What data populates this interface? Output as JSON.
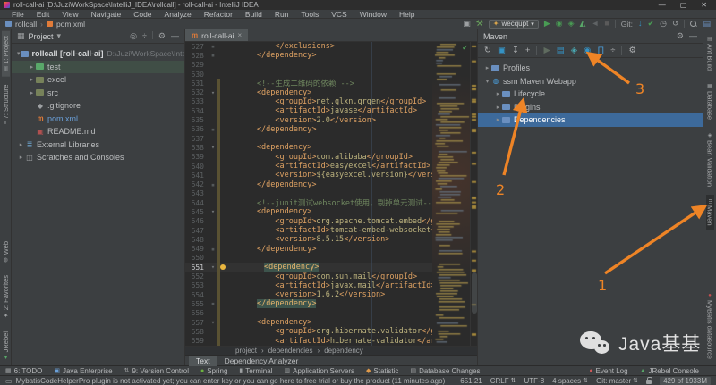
{
  "window": {
    "title": "roll-call-ai [D:\\Juzi\\WorkSpace\\IntelliJ_IDEA\\rollcall] - roll-call-ai - IntelliJ IDEA",
    "minimize": "—",
    "maximize": "▢",
    "close": "✕"
  },
  "menubar": [
    "File",
    "Edit",
    "View",
    "Navigate",
    "Code",
    "Analyze",
    "Refactor",
    "Build",
    "Run",
    "Tools",
    "VCS",
    "Window",
    "Help"
  ],
  "navbar": {
    "crumbs": [
      {
        "label": "rollcall",
        "icon": "module-icon",
        "color": "#6a8fbf"
      },
      {
        "label": "pom.xml",
        "icon": "maven-file-icon",
        "color": "#e07b39"
      }
    ],
    "crumb_sep": "›",
    "left_icons": [
      {
        "name": "tool-layout-icon",
        "g": "▣",
        "c": "#9da0a2"
      },
      {
        "name": "build-hammer-icon",
        "g": "⚒",
        "c": "#6ba65d"
      }
    ],
    "run_config": {
      "icon": "tomcat-icon",
      "label": "wecqupt",
      "arrow": "▾"
    },
    "run_icons": [
      {
        "name": "run-icon",
        "g": "▶",
        "c": "#499c54"
      },
      {
        "name": "debug-icon",
        "g": "◉",
        "c": "#499c54"
      },
      {
        "name": "coverage-icon",
        "g": "◈",
        "c": "#499c54"
      },
      {
        "name": "profiler-icon",
        "g": "◭",
        "c": "#59a869"
      },
      {
        "name": "rerun-icon",
        "g": "◄",
        "c": "#5f6365"
      },
      {
        "name": "stop-icon",
        "g": "■",
        "c": "#5a5a5a"
      }
    ],
    "git_label": "Git:",
    "git_icons": [
      {
        "name": "git-update-icon",
        "g": "↓",
        "c": "#3592c4"
      },
      {
        "name": "git-commit-icon",
        "g": "✔",
        "c": "#499c54"
      },
      {
        "name": "history-icon",
        "g": "◷",
        "c": "#9da0a2"
      },
      {
        "name": "rollback-icon",
        "g": "↺",
        "c": "#9da0a2"
      }
    ],
    "tail_icons": [
      {
        "name": "search-everywhere-icon",
        "g": "MAG",
        "c": "#9da0a2"
      },
      {
        "name": "bookmarks-icon",
        "g": "▤",
        "c": "#6a8fbf"
      }
    ]
  },
  "left_stripe": {
    "top": [
      {
        "label": "1: Project",
        "icon": "▥",
        "active": true
      },
      {
        "label": "7: Structure",
        "icon": "≡",
        "active": false
      }
    ],
    "bottom": [
      {
        "label": "Web",
        "icon": "◍",
        "active": false
      },
      {
        "label": "2: Favorites",
        "icon": "★",
        "active": false
      },
      {
        "label": "JRebel",
        "icon": "▲",
        "active": false,
        "iconColor": "#59a869"
      }
    ]
  },
  "right_stripe": {
    "top": [
      {
        "label": "Ant Build",
        "icon": "▤",
        "active": false
      },
      {
        "label": "Database",
        "icon": "▦",
        "active": false
      },
      {
        "label": "Bean Validation",
        "icon": "◈",
        "active": false
      },
      {
        "label": "Maven",
        "icon": "m",
        "active": true
      }
    ],
    "bottom": [
      {
        "label": "MyBatis datasource",
        "icon": "●",
        "active": false,
        "iconColor": "#c24f4f"
      }
    ]
  },
  "project_panel": {
    "title": "Project",
    "title_arrow": "▾",
    "title_icon": "panel-folder-icon",
    "header_icons": [
      {
        "name": "locate-icon",
        "g": "◎"
      },
      {
        "name": "collapse-all-icon",
        "g": "÷"
      },
      {
        "name": "sep",
        "g": "|"
      },
      {
        "name": "settings-gear-icon",
        "g": "⚙"
      },
      {
        "name": "hide-icon",
        "g": "—"
      }
    ],
    "tree": [
      {
        "label": "rollcall [roll-call-ai]",
        "path": "D:\\Juzi\\WorkSpace\\IntelliJ_IDEA\\rollcall",
        "icon": "module",
        "iconColor": "#6a8fbf",
        "arrow": "▾",
        "indent": 0,
        "bold": true
      },
      {
        "label": "test",
        "icon": "folder",
        "iconColor": "#59a869",
        "arrow": "▸",
        "indent": 1,
        "scope": true
      },
      {
        "label": "excel",
        "icon": "folder",
        "iconColor": "#77825a",
        "arrow": "▸",
        "indent": 1
      },
      {
        "label": "src",
        "icon": "folder",
        "iconColor": "#77825a",
        "arrow": "▸",
        "indent": 1
      },
      {
        "label": ".gitignore",
        "icon": "git-file",
        "glyph": "◆",
        "iconColor": "#9da0a2",
        "indent": 1
      },
      {
        "label": "pom.xml",
        "icon": "maven-file",
        "glyph": "m",
        "iconColor": "#e07b39",
        "indent": 1,
        "labelColor": "#6a9fd8"
      },
      {
        "label": "README.md",
        "icon": "readme-file",
        "glyph": "▣",
        "iconColor": "#b05050",
        "indent": 1
      },
      {
        "label": "External Libraries",
        "icon": "libraries",
        "glyph": "≣",
        "iconColor": "#6897bb",
        "arrow": "▸",
        "indent": 0
      },
      {
        "label": "Scratches and Consoles",
        "icon": "scratches",
        "glyph": "◫",
        "iconColor": "#9da0a2",
        "arrow": "▸",
        "indent": 0
      }
    ]
  },
  "editor": {
    "tab": {
      "icon": "m",
      "label": "roll-call-ai",
      "close": "×"
    },
    "inspection_ok": "✔",
    "breadcrumbs": [
      "project",
      "dependencies",
      "dependency"
    ],
    "crumb_sep": "›",
    "view_tabs": [
      {
        "label": "Text",
        "active": true
      },
      {
        "label": "Dependency Analyzer",
        "active": false
      }
    ],
    "lines": [
      {
        "n": 627,
        "end": true,
        "s": [
          [
            "            </exclusions>",
            "t"
          ]
        ]
      },
      {
        "n": 628,
        "end": true,
        "s": [
          [
            "        </dependency>",
            "t"
          ]
        ]
      },
      {
        "n": 629,
        "s": []
      },
      {
        "n": 630,
        "s": []
      },
      {
        "n": 631,
        "chg": true,
        "s": [
          [
            "        ",
            "w"
          ],
          [
            "<!--生成二维码的依赖 -->",
            "c"
          ]
        ]
      },
      {
        "n": 632,
        "fold": true,
        "chg": true,
        "s": [
          [
            "        <dependency>",
            "t"
          ]
        ]
      },
      {
        "n": 633,
        "chg": true,
        "s": [
          [
            "            <groupId>",
            "t"
          ],
          [
            "net.glxn.qrgen",
            "v"
          ],
          [
            "</groupId>",
            "t"
          ]
        ]
      },
      {
        "n": 634,
        "chg": true,
        "s": [
          [
            "            <artifactId>",
            "t"
          ],
          [
            "javase",
            "v"
          ],
          [
            "</artifactId>",
            "t"
          ]
        ]
      },
      {
        "n": 635,
        "chg": true,
        "s": [
          [
            "            <version>",
            "t"
          ],
          [
            "2.0",
            "v"
          ],
          [
            "</version>",
            "t"
          ]
        ]
      },
      {
        "n": 636,
        "end": true,
        "chg": true,
        "s": [
          [
            "        </dependency>",
            "t"
          ]
        ]
      },
      {
        "n": 637,
        "chg": true,
        "s": []
      },
      {
        "n": 638,
        "fold": true,
        "chg": true,
        "s": [
          [
            "        <dependency>",
            "t"
          ]
        ]
      },
      {
        "n": 639,
        "chg": true,
        "s": [
          [
            "            <groupId>",
            "t"
          ],
          [
            "com.alibaba",
            "v"
          ],
          [
            "</groupId>",
            "t"
          ]
        ]
      },
      {
        "n": 640,
        "chg": true,
        "s": [
          [
            "            <artifactId>",
            "t"
          ],
          [
            "easyexcel",
            "v"
          ],
          [
            "</artifactId>",
            "t"
          ]
        ]
      },
      {
        "n": 641,
        "chg": true,
        "s": [
          [
            "            <version>",
            "t"
          ],
          [
            "${easyexcel.version}",
            "v"
          ],
          [
            "</version>",
            "t"
          ]
        ]
      },
      {
        "n": 642,
        "end": true,
        "chg": true,
        "s": [
          [
            "        </dependency>",
            "t"
          ]
        ]
      },
      {
        "n": 643,
        "chg": true,
        "s": []
      },
      {
        "n": 644,
        "chg": true,
        "s": [
          [
            "        ",
            "w"
          ],
          [
            "<!--junit测试websocket使用，剔掉单元测试-->",
            "c"
          ]
        ]
      },
      {
        "n": 645,
        "fold": true,
        "chg": true,
        "s": [
          [
            "        <dependency>",
            "t"
          ]
        ]
      },
      {
        "n": 646,
        "chg": true,
        "s": [
          [
            "            <groupId>",
            "t"
          ],
          [
            "org.apache.tomcat.embed",
            "v"
          ],
          [
            "</groupId>",
            "t"
          ]
        ]
      },
      {
        "n": 647,
        "chg": true,
        "s": [
          [
            "            <artifactId>",
            "t"
          ],
          [
            "tomcat-embed-websocket",
            "v"
          ],
          [
            "</artifactId>",
            "t"
          ]
        ]
      },
      {
        "n": 648,
        "chg": true,
        "s": [
          [
            "            <version>",
            "t"
          ],
          [
            "8.5.15",
            "v"
          ],
          [
            "</version>",
            "t"
          ]
        ]
      },
      {
        "n": 649,
        "end": true,
        "chg": true,
        "s": [
          [
            "        </dependency>",
            "t"
          ]
        ]
      },
      {
        "n": 650,
        "chg": true,
        "s": []
      },
      {
        "n": 651,
        "fold": true,
        "chg": true,
        "cur": true,
        "bulb": true,
        "s": [
          [
            "        ",
            "w"
          ],
          [
            "<dependency>",
            "th"
          ]
        ]
      },
      {
        "n": 652,
        "chg": true,
        "s": [
          [
            "            <groupId>",
            "t"
          ],
          [
            "com.sun.mail",
            "v"
          ],
          [
            "</groupId>",
            "t"
          ]
        ]
      },
      {
        "n": 653,
        "chg": true,
        "s": [
          [
            "            <artifactId>",
            "t"
          ],
          [
            "javax.mail",
            "v"
          ],
          [
            "</artifactId>",
            "t"
          ]
        ]
      },
      {
        "n": 654,
        "chg": true,
        "s": [
          [
            "            <version>",
            "t"
          ],
          [
            "1.6.2",
            "v"
          ],
          [
            "</version>",
            "t"
          ]
        ]
      },
      {
        "n": 655,
        "end": true,
        "chg": true,
        "s": [
          [
            "        ",
            "w"
          ],
          [
            "</dependency>",
            "th"
          ]
        ]
      },
      {
        "n": 656,
        "chg": true,
        "s": []
      },
      {
        "n": 657,
        "fold": true,
        "chg": true,
        "s": [
          [
            "        <dependency>",
            "t"
          ]
        ]
      },
      {
        "n": 658,
        "chg": true,
        "s": [
          [
            "            <groupId>",
            "t"
          ],
          [
            "org.hibernate.validator",
            "v"
          ],
          [
            "</groupId>",
            "t"
          ]
        ]
      },
      {
        "n": 659,
        "chg": true,
        "s": [
          [
            "            <artifactId>",
            "t"
          ],
          [
            "hibernate-validator",
            "v"
          ],
          [
            "</artifactId>",
            "t"
          ]
        ]
      }
    ]
  },
  "maven_panel": {
    "title": "Maven",
    "header_icons": [
      {
        "name": "settings-gear-icon",
        "g": "⚙"
      },
      {
        "name": "hide-icon",
        "g": "—"
      }
    ],
    "toolbar": [
      {
        "name": "reimport-maven-icon",
        "g": "↻",
        "c": "#afb1b3"
      },
      {
        "name": "generate-sources-icon",
        "g": "▣",
        "c": "#3592c4"
      },
      {
        "name": "download-sources-icon",
        "g": "↧",
        "c": "#afb1b3"
      },
      {
        "name": "add-maven-project-icon",
        "g": "+",
        "c": "#afb1b3"
      },
      {
        "name": "sep",
        "g": "|"
      },
      {
        "name": "run-goal-icon",
        "g": "▶",
        "c": "#5f6b5f"
      },
      {
        "name": "maven-settings-icon",
        "g": "▤",
        "c": "#3592c4"
      },
      {
        "name": "execute-goal-icon",
        "g": "◈",
        "c": "#49a6b0"
      },
      {
        "name": "offline-mode-icon",
        "g": "◉",
        "c": "#3592c4"
      },
      {
        "name": "skip-tests-icon",
        "g": "∏",
        "c": "#4a9edb"
      },
      {
        "name": "collapse-all-icon",
        "g": "÷",
        "c": "#afb1b3"
      },
      {
        "name": "sep",
        "g": "|"
      },
      {
        "name": "maven-wrench-icon",
        "g": "⚙",
        "c": "#afb1b3"
      }
    ],
    "tree": [
      {
        "label": "Profiles",
        "icon": "folder",
        "iconColor": "#6a8fbf",
        "arrow": "▸",
        "indent": 0
      },
      {
        "label": "ssm Maven Webapp",
        "icon": "maven-project",
        "glyph": "◍",
        "iconColor": "#4a9edb",
        "arrow": "▾",
        "indent": 0
      },
      {
        "label": "Lifecycle",
        "icon": "folder",
        "iconColor": "#6a8fbf",
        "arrow": "▸",
        "indent": 1
      },
      {
        "label": "Plugins",
        "icon": "folder",
        "iconColor": "#6a8fbf",
        "arrow": "▸",
        "indent": 1
      },
      {
        "label": "Dependencies",
        "icon": "folder",
        "iconColor": "#6a8fbf",
        "arrow": "▸",
        "indent": 1,
        "selected": true
      }
    ]
  },
  "annotations": {
    "step1": "1",
    "step2": "2",
    "step3": "3",
    "arrow_color": "#ee8426"
  },
  "toolwindow_bar": {
    "left": [
      {
        "label": "6: TODO",
        "g": "▦",
        "c": "#9da0a2"
      },
      {
        "label": "Java Enterprise",
        "g": "▣",
        "c": "#6a9fd8"
      },
      {
        "label": "9: Version Control",
        "g": "⇅",
        "c": "#9da0a2"
      },
      {
        "label": "Spring",
        "g": "●",
        "c": "#6db33f"
      },
      {
        "label": "Terminal",
        "g": "▮",
        "c": "#9da0a2"
      },
      {
        "label": "Application Servers",
        "g": "▥",
        "c": "#9da0a2"
      },
      {
        "label": "Statistic",
        "g": "◆",
        "c": "#e09a4a"
      },
      {
        "label": "Database Changes",
        "g": "▤",
        "c": "#9da0a2"
      }
    ],
    "right": [
      {
        "label": "Event Log",
        "g": "●",
        "c": "#d45a5a"
      },
      {
        "label": "JRebel Console",
        "g": "▲",
        "c": "#59a869"
      }
    ]
  },
  "statusbar": {
    "message": "MybatisCodeHelperPro plugin is not activated yet; you can enter key or you can go here to free trial or buy the product (11 minutes ago)",
    "position": "651:21",
    "line_sep": "CRLF",
    "updown": "⇅",
    "encoding": "UTF-8",
    "indent": "4 spaces",
    "git": "Git: master",
    "heap": "429 of 1933M"
  },
  "watermark": {
    "text": "Java基基",
    "icon": "wechat-icon"
  },
  "colors": {
    "panel_bg": "#3c3f41",
    "editor_bg": "#2b2b2b",
    "selection_blue": "#3d6a9b",
    "xml_tag": "#dfa263",
    "xml_value": "#bdb37e",
    "xml_comment": "#6f875f",
    "vcs_change": "#5a5233",
    "arrow_orange": "#ee8426",
    "run_green": "#499c54"
  }
}
